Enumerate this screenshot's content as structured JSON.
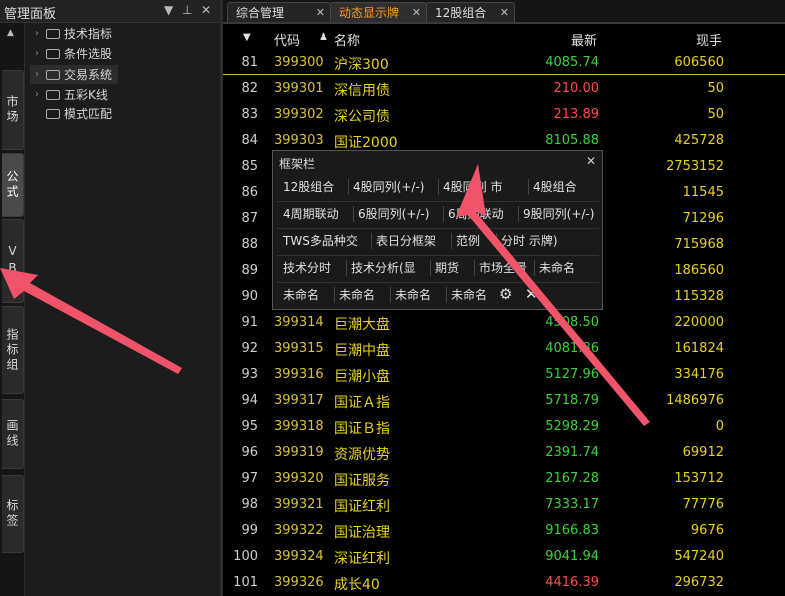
{
  "left_panel": {
    "title": "管理面板",
    "vtabs": [
      {
        "label": "市场"
      },
      {
        "label": "公式"
      },
      {
        "label": "VB"
      },
      {
        "label": "指标组"
      },
      {
        "label": "画线"
      },
      {
        "label": "标签"
      }
    ],
    "tree": [
      {
        "label": "技术指标"
      },
      {
        "label": "条件选股"
      },
      {
        "label": "交易系统"
      },
      {
        "label": "五彩K线"
      },
      {
        "label": "模式匹配"
      }
    ]
  },
  "tabs": [
    {
      "label": "综合管理"
    },
    {
      "label": "动态显示牌"
    },
    {
      "label": "12股组合"
    }
  ],
  "grid": {
    "headers": {
      "code": "代码",
      "name": "名称",
      "price": "最新",
      "vol": "现手"
    },
    "rows": [
      {
        "idx": "81",
        "code": "399300",
        "name": "沪深300",
        "price": "4085.74",
        "dir": "down",
        "vol": "606560"
      },
      {
        "idx": "82",
        "code": "399301",
        "name": "深信用债",
        "price": "210.00",
        "dir": "up",
        "vol": "50"
      },
      {
        "idx": "83",
        "code": "399302",
        "name": "深公司债",
        "price": "213.89",
        "dir": "up",
        "vol": "50"
      },
      {
        "idx": "84",
        "code": "399303",
        "name": "国证2000",
        "price": "8105.88",
        "dir": "down",
        "vol": "425728"
      },
      {
        "idx": "85",
        "code": "",
        "name": "",
        "price": "",
        "dir": "down",
        "vol": "2753152"
      },
      {
        "idx": "86",
        "code": "",
        "name": "",
        "price": "",
        "dir": "down",
        "vol": "11545"
      },
      {
        "idx": "87",
        "code": "",
        "name": "",
        "price": "",
        "dir": "down",
        "vol": "71296"
      },
      {
        "idx": "88",
        "code": "",
        "name": "",
        "price": "",
        "dir": "down",
        "vol": "715968"
      },
      {
        "idx": "89",
        "code": "",
        "name": "",
        "price": "",
        "dir": "down",
        "vol": "186560"
      },
      {
        "idx": "90",
        "code": "",
        "name": "",
        "price": "",
        "dir": "down",
        "vol": "115328"
      },
      {
        "idx": "91",
        "code": "399314",
        "name": "巨潮大盘",
        "price": "4508.50",
        "dir": "down",
        "vol": "220000"
      },
      {
        "idx": "92",
        "code": "399315",
        "name": "巨潮中盘",
        "price": "4081.86",
        "dir": "down",
        "vol": "161824"
      },
      {
        "idx": "93",
        "code": "399316",
        "name": "巨潮小盘",
        "price": "5127.96",
        "dir": "down",
        "vol": "334176"
      },
      {
        "idx": "94",
        "code": "399317",
        "name": "国证Ａ指",
        "price": "5718.79",
        "dir": "down",
        "vol": "1486976"
      },
      {
        "idx": "95",
        "code": "399318",
        "name": "国证Ｂ指",
        "price": "5298.29",
        "dir": "down",
        "vol": "0"
      },
      {
        "idx": "96",
        "code": "399319",
        "name": "资源优势",
        "price": "2391.74",
        "dir": "down",
        "vol": "69912"
      },
      {
        "idx": "97",
        "code": "399320",
        "name": "国证服务",
        "price": "2167.28",
        "dir": "down",
        "vol": "153712"
      },
      {
        "idx": "98",
        "code": "399321",
        "name": "国证红利",
        "price": "7333.17",
        "dir": "down",
        "vol": "77776"
      },
      {
        "idx": "99",
        "code": "399322",
        "name": "国证治理",
        "price": "9166.83",
        "dir": "down",
        "vol": "9676"
      },
      {
        "idx": "100",
        "code": "399324",
        "name": "深证红利",
        "price": "9041.94",
        "dir": "down",
        "vol": "547240"
      },
      {
        "idx": "101",
        "code": "399326",
        "name": "成长40",
        "price": "4416.39",
        "dir": "up",
        "vol": "296732"
      }
    ]
  },
  "popup": {
    "title": "框架栏",
    "rows": [
      [
        "12股组合",
        "4股同列(+/-)",
        "4股同列 市",
        "4股组合"
      ],
      [
        "4周期联动",
        "6股同列(+/-)",
        "6周期联动",
        "9股同列(+/-)"
      ],
      [
        "TWS多品种交",
        "表日分框架",
        "范例",
        "分时 示牌)"
      ],
      [
        "技术分时",
        "技术分析(显",
        "期货",
        "市场全景",
        "未命名"
      ],
      [
        "未命名",
        "未命名",
        "未命名",
        "未命名"
      ]
    ]
  },
  "colors": {
    "up": "#ff4a4a",
    "down": "#3bd13b",
    "code": "#d9c23a",
    "arrow": "#f0546a",
    "active_tab": "#f39a3a"
  }
}
